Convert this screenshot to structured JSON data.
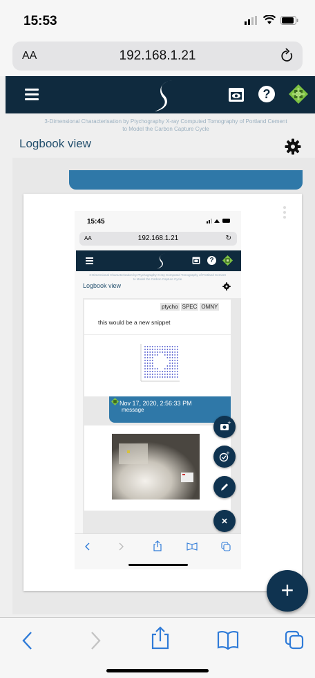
{
  "status": {
    "time": "15:53"
  },
  "browser": {
    "text_size_label": "AA",
    "address": "192.168.1.21"
  },
  "app": {
    "subtitle": "3-Dimensional Characterisation by Ptychography X-ray Computed Tomography of Portland Cement to Model the Carbon Capture Cycle",
    "view_title": "Logbook view"
  },
  "embedded_screenshot": {
    "status": {
      "time": "15:45"
    },
    "browser": {
      "text_size_label": "AA",
      "address": "192.168.1.21"
    },
    "app": {
      "subtitle": "3-Dimensional Characterisation by Ptychography X-ray Computed Tomography of Portland Cement to Model the Carbon Capture Cycle",
      "view_title": "Logbook view"
    },
    "tags": [
      "ptycho",
      "SPEC",
      "OMNY"
    ],
    "snippet_text": "this would be a new snippet",
    "message": {
      "date": "Nov 17, 2020, 2:56:33 PM",
      "text": "message"
    },
    "fab_actions": [
      "camera",
      "check",
      "edit",
      "close"
    ]
  },
  "fab": {
    "label": "+"
  },
  "colors": {
    "header": "#0f2a3e",
    "accent": "#2f78a8",
    "fab": "#0f3350",
    "title": "#24506e"
  }
}
